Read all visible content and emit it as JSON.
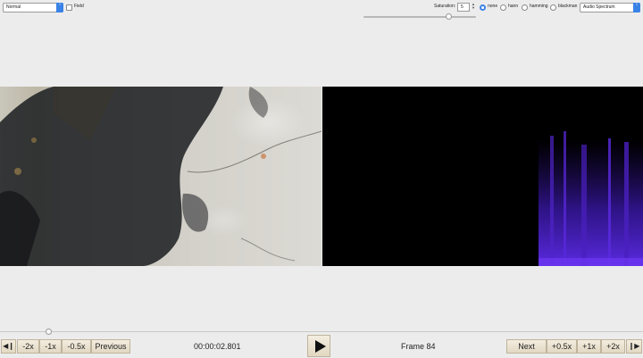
{
  "toolbar": {
    "mode_select_value": "Normal",
    "field_label": "Field",
    "saturation_label": "Saturation:",
    "saturation_value": "5",
    "saturation_slider_fraction": 0.75,
    "window_options": [
      {
        "label": "none",
        "selected": true
      },
      {
        "label": "hann",
        "selected": false
      },
      {
        "label": "hamming",
        "selected": false
      },
      {
        "label": "blackman",
        "selected": false
      }
    ],
    "view_select_value": "Audio Spectrum"
  },
  "playback": {
    "time": "00:00:02.801",
    "frame": "Frame 84",
    "position_fraction": 0.075,
    "left_buttons": [
      "-2x",
      "-1x",
      "-0.5x",
      "Previous"
    ],
    "right_buttons": [
      "Next",
      "+0.5x",
      "+1x",
      "+2x"
    ]
  },
  "colors": {
    "accent": "#3b82e6",
    "button_bg": "#ebe3d0",
    "spectrum_bg": "#000000",
    "spectrum_band": "#4a22c8"
  }
}
